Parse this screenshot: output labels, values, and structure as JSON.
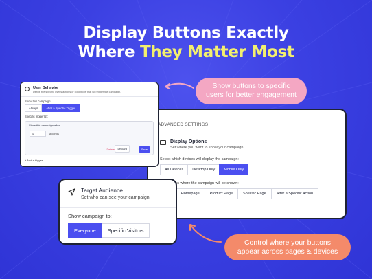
{
  "hero": {
    "line1": "Display Buttons Exactly",
    "line2_prefix": "Where ",
    "line2_highlight": "They Matter Most",
    "highlight_color": "#f3f06e"
  },
  "user_behavior": {
    "title": "User Behavior",
    "subtitle": "Define the specific user's actions or conditions that will trigger the campaign.",
    "show_label": "Show this campaign:",
    "options": [
      "Always",
      "After a Specific Trigger"
    ],
    "selected": "After a Specific Trigger",
    "triggers_label": "Specific trigger(s):",
    "trigger_box_title": "Show this campaign after",
    "seconds_value": "5",
    "seconds_unit": "seconds",
    "delete_label": "Delete",
    "discard_label": "Discard",
    "save_label": "Save",
    "add_trigger": "+ Add a trigger"
  },
  "advanced": {
    "header": "ADVANCED SETTINGS",
    "display_title": "Display Options",
    "display_subtitle": "Set where you want to show your campaign.",
    "devices_question": "Select which devices will display the campaign:",
    "devices": [
      "All Devices",
      "Desktop Only",
      "Mobile Only"
    ],
    "selected_device": "Mobile Only",
    "pages_question": "pages where the campaign will be shown:",
    "pages": [
      "s",
      "Homepage",
      "Product Page",
      "Specific Page",
      "After a Specific Action"
    ],
    "selected_page": "s"
  },
  "target": {
    "title": "Target Audience",
    "subtitle": "Set who can see your campaign.",
    "question": "Show campaign to:",
    "options": [
      "Everyone",
      "Specific Visitors"
    ],
    "selected": "Everyone"
  },
  "callouts": {
    "top_line1": "Show buttons to specific",
    "top_line2": "users for better engagement",
    "bottom_line1": "Control where your buttons",
    "bottom_line2": "appear across pages & devices"
  },
  "colors": {
    "background": "#3a3fe0",
    "accent": "#4b4ff0",
    "pink_pill": "#f4a7c3",
    "orange_pill": "#f48a6a"
  }
}
